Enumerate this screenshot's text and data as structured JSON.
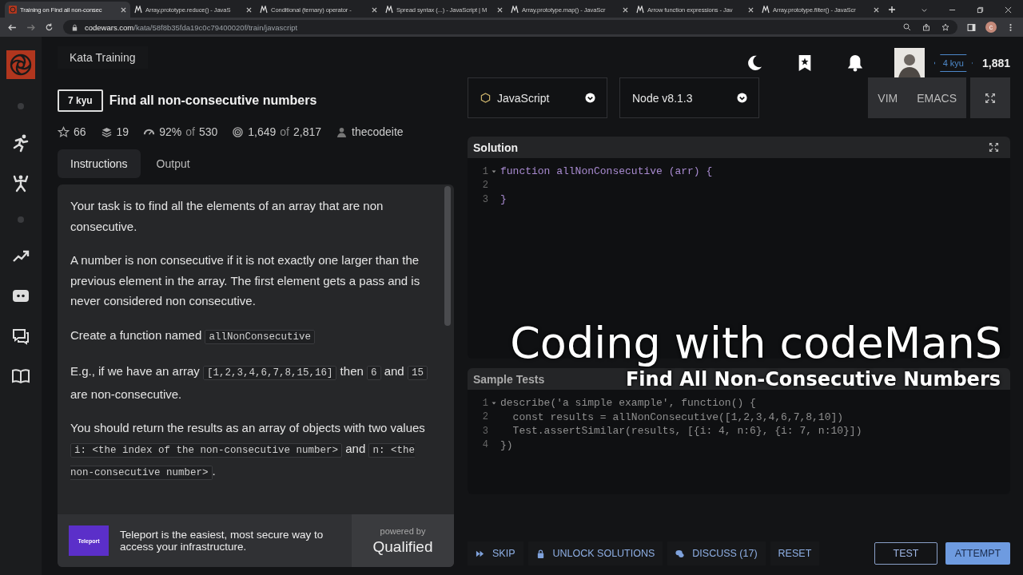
{
  "browser": {
    "tabs": [
      {
        "title": "Training on Find all non-consec",
        "selected": true,
        "kind": "codewars"
      },
      {
        "title": "Array.prototype.reduce() - JavaS",
        "selected": false,
        "kind": "mdn"
      },
      {
        "title": "Conditional (ternary) operator -",
        "selected": false,
        "kind": "mdn"
      },
      {
        "title": "Spread syntax (...) - JavaScript | M",
        "selected": false,
        "kind": "mdn"
      },
      {
        "title": "Array.prototype.map() - JavaScr",
        "selected": false,
        "kind": "mdn"
      },
      {
        "title": "Arrow function expressions - Jav",
        "selected": false,
        "kind": "mdn"
      },
      {
        "title": "Array.prototype.filter() - JavaScr",
        "selected": false,
        "kind": "mdn"
      }
    ],
    "url_host": "codewars.com",
    "url_path": "/kata/58f8b35fda19c0c79400020f/train/javascript",
    "profile_initial": "c"
  },
  "header": {
    "section": "Kata Training",
    "user_rank": "4 kyu",
    "honor": "1,881"
  },
  "kata": {
    "rank": "7 kyu",
    "title": "Find all non-consecutive numbers",
    "stats": [
      {
        "kind": "stars",
        "value": "66"
      },
      {
        "kind": "collections",
        "value": "19"
      },
      {
        "kind": "satisfaction",
        "value": "92%",
        "of": "of",
        "total": "530"
      },
      {
        "kind": "completed",
        "value": "1,649",
        "of": "of",
        "total": "2,817"
      },
      {
        "kind": "author",
        "value": "thecodeite"
      }
    ]
  },
  "tabs": [
    {
      "label": "Instructions",
      "selected": true
    },
    {
      "label": "Output",
      "selected": false
    }
  ],
  "instructions": [
    [
      {
        "text": "Your task is to find all the elements of an array that are non consecutive.",
        "kind": "text"
      }
    ],
    [
      {
        "text": "A number is non consecutive if it is not exactly one larger than the previous element in the array. The first element gets a pass and is never considered non consecutive.",
        "kind": "text"
      }
    ],
    [
      {
        "text": "Create a function named ",
        "kind": "text"
      },
      {
        "text": "allNonConsecutive",
        "kind": "code"
      }
    ],
    [
      {
        "text": "E.g., if we have an array ",
        "kind": "text"
      },
      {
        "text": "[1,2,3,4,6,7,8,15,16]",
        "kind": "code"
      },
      {
        "text": " then ",
        "kind": "text"
      },
      {
        "text": "6",
        "kind": "code"
      },
      {
        "text": " and ",
        "kind": "text"
      },
      {
        "text": "15",
        "kind": "code"
      },
      {
        "text": " are non-consecutive.",
        "kind": "text"
      }
    ],
    [
      {
        "text": "You should return the results as an array of objects with two values ",
        "kind": "text"
      },
      {
        "text": "i: <the index of the non-consecutive number>",
        "kind": "code"
      },
      {
        "text": " and ",
        "kind": "text"
      },
      {
        "text": "n: <the non-consecutive number>",
        "kind": "code"
      },
      {
        "text": ".",
        "kind": "text"
      }
    ]
  ],
  "ad": {
    "text": "Teleport is the easiest, most secure way to access your infrastructure.",
    "logo": "Teleport",
    "powered_by": "powered by",
    "brand": "Qualified"
  },
  "language": {
    "label": "JavaScript"
  },
  "runtime": {
    "label": "Node v8.1.3"
  },
  "modes": [
    "VIM",
    "EMACS"
  ],
  "solution": {
    "title": "Solution",
    "lines": [
      {
        "no": "1",
        "text": "function allNonConsecutive (arr) {",
        "fold": true
      },
      {
        "no": "2",
        "fold": false
      },
      {
        "no": "3",
        "text": "}",
        "fold": false
      }
    ]
  },
  "sample_tests": {
    "title": "Sample Tests",
    "lines": [
      {
        "no": "1",
        "text": "describe('a simple example', function() {",
        "fold": true
      },
      {
        "no": "2",
        "text": "  const results = allNonConsecutive([1,2,3,4,6,7,8,10])",
        "fold": false
      },
      {
        "no": "3",
        "text": "  Test.assertSimilar(results, [{i: 4, n:6}, {i: 7, n:10}])",
        "fold": false
      },
      {
        "no": "4",
        "text": "})",
        "fold": false
      }
    ]
  },
  "actions": [
    {
      "kind": "skip",
      "label": "SKIP"
    },
    {
      "kind": "unlock",
      "label": "UNLOCK SOLUTIONS"
    },
    {
      "kind": "discuss",
      "label": "DISCUSS (17)"
    },
    {
      "kind": "reset",
      "label": "RESET"
    }
  ],
  "test_button": "TEST",
  "attempt_button": "ATTEMPT",
  "video_overlay": {
    "title": "Coding with codeManS",
    "subtitle": "Find All Non-Consecutive Numbers"
  }
}
